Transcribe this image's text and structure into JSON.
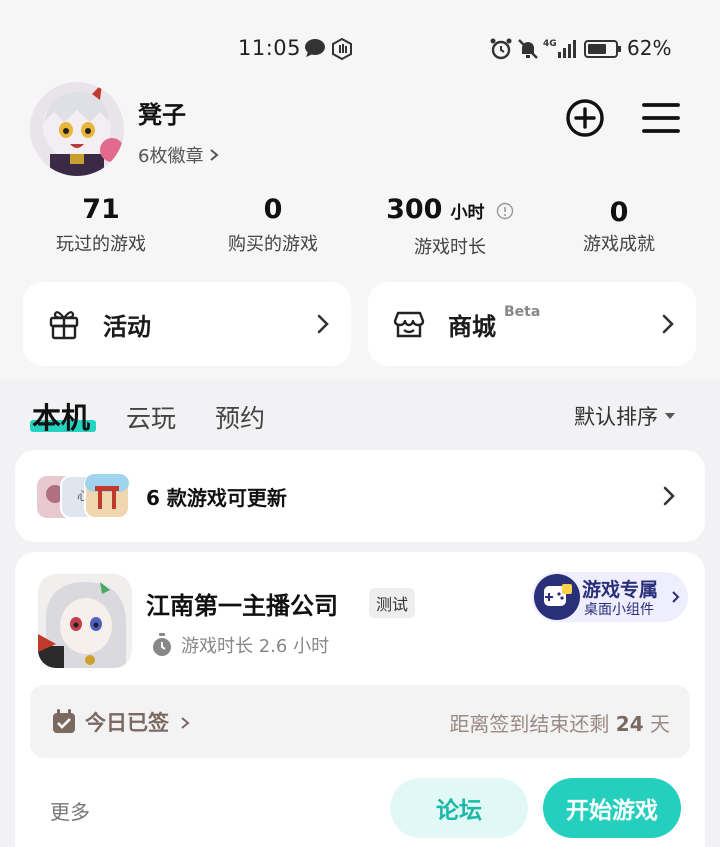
{
  "status_bar": {
    "time": "11:05",
    "network": "4G",
    "battery_percent": "62%",
    "icons": [
      "chat-bubble-icon",
      "hand-icon",
      "alarm-icon",
      "mute-icon",
      "signal-icon",
      "battery-icon"
    ]
  },
  "profile": {
    "username": "凳子",
    "badges_text": "6枚徽章"
  },
  "stats": [
    {
      "value": "71",
      "label": "玩过的游戏"
    },
    {
      "value": "0",
      "label": "购买的游戏"
    },
    {
      "value": "300",
      "unit": "小时",
      "label": "游戏时长"
    },
    {
      "value": "0",
      "label": "游戏成就"
    }
  ],
  "entries": {
    "activity": {
      "label": "活动",
      "icon": "gift-icon"
    },
    "shop": {
      "label": "商城",
      "badge": "Beta",
      "icon": "shop-icon"
    }
  },
  "tabs": [
    {
      "label": "本机",
      "active": true
    },
    {
      "label": "云玩",
      "active": false
    },
    {
      "label": "预约",
      "active": false
    }
  ],
  "sort": {
    "label": "默认排序"
  },
  "updates": {
    "text": "6 款游戏可更新"
  },
  "game": {
    "title": "江南第一主播公司",
    "tag": "测试",
    "playtime": "游戏时长 2.6 小时",
    "widget": {
      "title": "游戏专属",
      "subtitle": "桌面小组件"
    },
    "checkin": {
      "label": "今日已签",
      "remain_prefix": "距离签到结束还剩",
      "remain_days": "24",
      "remain_unit": "天"
    },
    "more_label": "更多",
    "forum_label": "论坛",
    "play_label": "开始游戏"
  },
  "colors": {
    "accent": "#24d0bd",
    "accent_light": "#e2f8f6",
    "widget_bg": "#eeeefe",
    "widget_text": "#2a2f7a",
    "checkin_text": "#7b6a62"
  }
}
